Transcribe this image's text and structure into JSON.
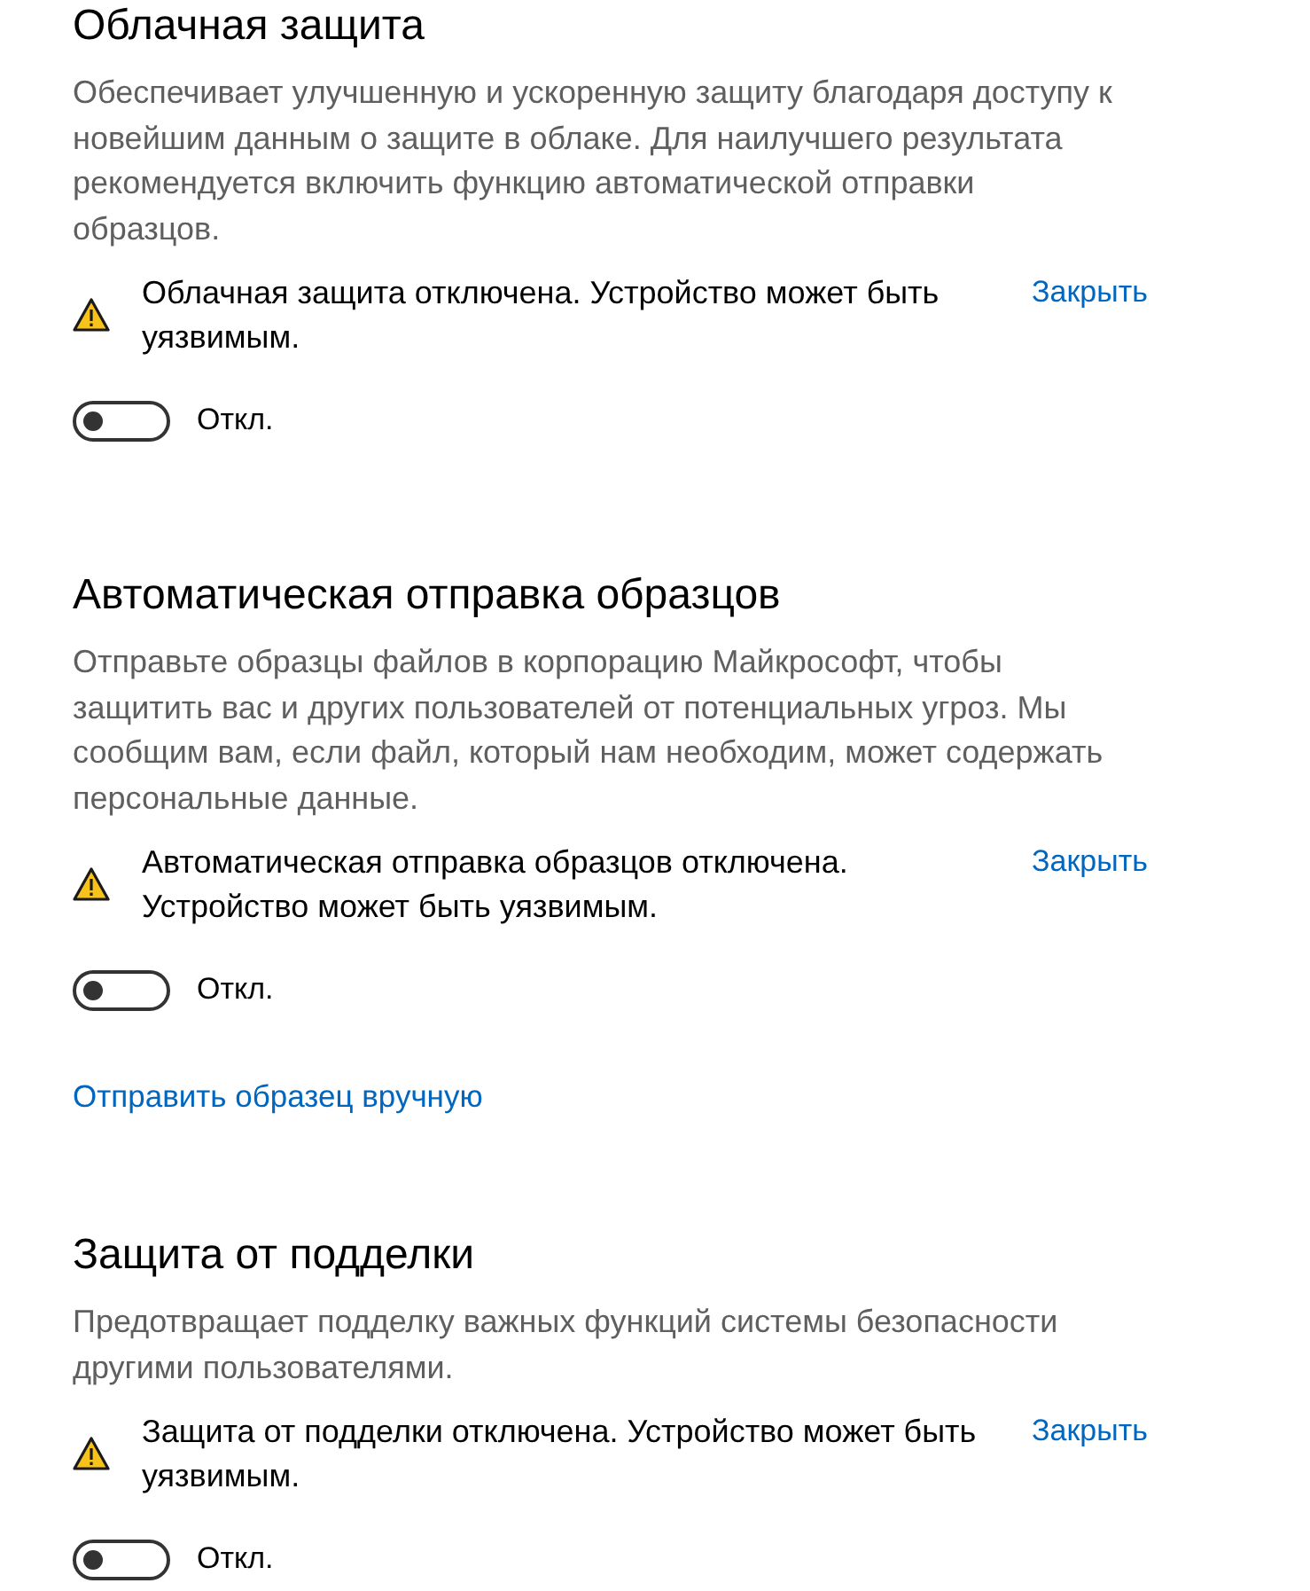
{
  "sections": [
    {
      "title": "Облачная защита",
      "description": "Обеспечивает улучшенную и ускоренную защиту благодаря доступу к новейшим данным о защите в облаке. Для наилучшего результата рекомендуется включить функцию автоматической отправки образцов.",
      "warning": {
        "text": "Облачная защита отключена. Устройство может быть уязвимым.",
        "close_label": "Закрыть"
      },
      "toggle": {
        "on": false,
        "label": "Откл."
      }
    },
    {
      "title": "Автоматическая отправка образцов",
      "description": "Отправьте образцы файлов в корпорацию Майкрософт, чтобы защитить вас и других пользователей от потенциальных угроз. Мы сообщим вам, если файл, который нам необходим, может содержать персональные данные.",
      "warning": {
        "text": "Автоматическая отправка образцов отключена. Устройство может быть уязвимым.",
        "close_label": "Закрыть"
      },
      "toggle": {
        "on": false,
        "label": "Откл."
      },
      "link": "Отправить образец вручную"
    },
    {
      "title": "Защита от подделки",
      "description": "Предотвращает подделку важных функций системы безопасности другими пользователями.",
      "warning": {
        "text": "Защита от подделки отключена. Устройство может быть уязвимым.",
        "close_label": "Закрыть"
      },
      "toggle": {
        "on": false,
        "label": "Откл."
      }
    }
  ]
}
